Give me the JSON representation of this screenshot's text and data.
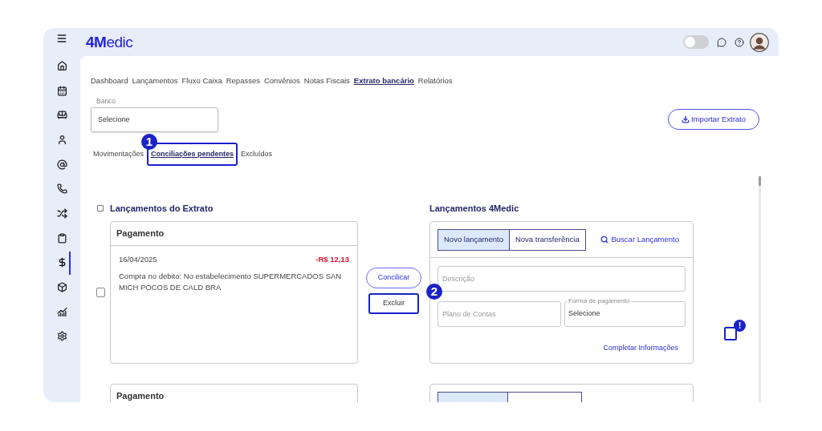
{
  "header": {
    "logo": "4Medic",
    "theme_toggle": {
      "on": false
    }
  },
  "sidebar": {
    "items": [
      {
        "selected": false
      },
      {
        "selected": false
      },
      {
        "selected": false
      },
      {
        "selected": false
      },
      {
        "selected": false
      },
      {
        "selected": false
      },
      {
        "selected": false
      },
      {
        "selected": false
      },
      {
        "selected": true
      },
      {
        "selected": false
      },
      {
        "selected": false
      },
      {
        "selected": false
      }
    ]
  },
  "nav_tabs": [
    {
      "label": "Dashboard",
      "selected": false
    },
    {
      "label": "Lançamentos",
      "selected": false
    },
    {
      "label": "Fluxo Caixa",
      "selected": false
    },
    {
      "label": "Repasses",
      "selected": false
    },
    {
      "label": "Convênios",
      "selected": false
    },
    {
      "label": "Notas Fiscais",
      "selected": false
    },
    {
      "label": "Extrato bancário",
      "selected": true
    },
    {
      "label": "Relatórios",
      "selected": false
    }
  ],
  "bank_field": {
    "label": "Banco",
    "value": "Selecione"
  },
  "import_button": "Importar Extrato",
  "sub_tabs": [
    {
      "label": "Movimentações",
      "selected": false
    },
    {
      "label": "Conciliações pendentes",
      "selected": true,
      "callout": "1"
    },
    {
      "label": "Excluídos",
      "selected": false
    }
  ],
  "statement_section": {
    "title": "Lançamentos do Extrato",
    "all_checked": false
  },
  "system_section": {
    "title": "Lançamentos 4Medic"
  },
  "rows": [
    {
      "checked": false,
      "statement": {
        "title": "Pagamento",
        "date": "16/04/2025",
        "amount": "-R$ 12,13",
        "description": "Compra no debito: No estabelecimento SUPERMERCADOS SAN MICH POCOS DE CALD BRA"
      },
      "reconcile_button": "Concilicar",
      "delete_button": {
        "label": "Excluir",
        "callout": "2"
      },
      "entry": {
        "tabs": [
          {
            "label": "Novo lançamento",
            "selected": true
          },
          {
            "label": "Nova transferência",
            "selected": false
          }
        ],
        "search_link": "Buscar Lançamento",
        "description_placeholder": "Descrição",
        "account_placeholder": "Plano de Contas",
        "payment_field": {
          "label": "Forma de pagamento",
          "value": "Selecione"
        },
        "complete_link": "Completar Informações"
      },
      "notice": "!"
    },
    {
      "statement": {
        "title": "Pagamento"
      },
      "entry": {
        "tabs": [
          {
            "selected": true
          },
          {
            "selected": false
          }
        ]
      }
    }
  ]
}
